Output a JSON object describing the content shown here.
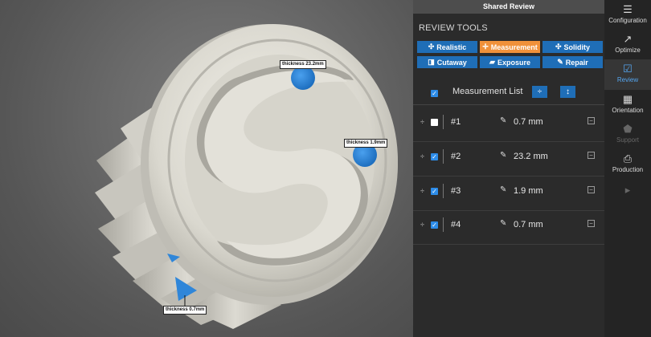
{
  "viewport": {
    "labels": [
      {
        "text": "thickness 23.2mm"
      },
      {
        "text": "thickness 1.9mm"
      },
      {
        "text": "thickness 0.7mm"
      }
    ]
  },
  "panel": {
    "header": "Shared Review",
    "section_title": "REVIEW TOOLS",
    "tools": [
      {
        "label": "Realistic",
        "icon": "✣",
        "active": false
      },
      {
        "label": "Measurement",
        "icon": "✛",
        "active": true
      },
      {
        "label": "Solidity",
        "icon": "✣",
        "active": false
      },
      {
        "label": "Cutaway",
        "icon": "◨",
        "active": false
      },
      {
        "label": "Exposure",
        "icon": "▰",
        "active": false
      },
      {
        "label": "Repair",
        "icon": "✎",
        "active": false
      }
    ],
    "measurement_list": {
      "title": "Measurement List",
      "all_checked": true,
      "rows": [
        {
          "num": "#1",
          "value": "0.7 mm",
          "checked": false
        },
        {
          "num": "#2",
          "value": "23.2 mm",
          "checked": true
        },
        {
          "num": "#3",
          "value": "1.9 mm",
          "checked": true
        },
        {
          "num": "#4",
          "value": "0.7 mm",
          "checked": true
        }
      ]
    }
  },
  "sidebar": {
    "items": [
      {
        "label": "Configuration",
        "icon": "sliders-icon",
        "active": false,
        "disabled": false
      },
      {
        "label": "Optimize",
        "icon": "chart-icon",
        "active": false,
        "disabled": false
      },
      {
        "label": "Review",
        "icon": "clipboard-check-icon",
        "active": true,
        "disabled": false
      },
      {
        "label": "Orientation",
        "icon": "blocks-icon",
        "active": false,
        "disabled": false
      },
      {
        "label": "Support",
        "icon": "support-icon",
        "active": false,
        "disabled": true
      },
      {
        "label": "Production",
        "icon": "printer-icon",
        "active": false,
        "disabled": false
      },
      {
        "label": "",
        "icon": "play-icon",
        "active": false,
        "disabled": true
      }
    ]
  },
  "colors": {
    "accent": "#1f6eb7",
    "active_tool": "#f0913a",
    "active_sidebar": "#55a6f0",
    "measure_marker": "#2f86d9"
  }
}
